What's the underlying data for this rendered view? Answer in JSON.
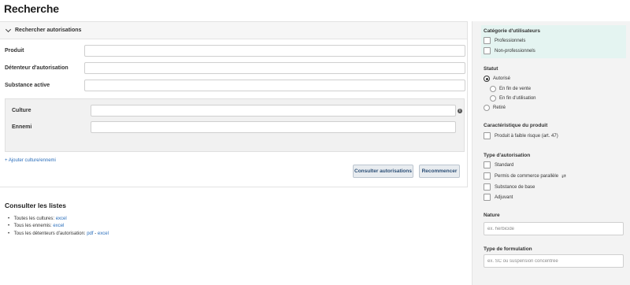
{
  "page": {
    "title": "Recherche"
  },
  "search": {
    "header_label": "Rechercher autorisations",
    "fields": {
      "produit_label": "Produit",
      "detenteur_label": "Détenteur d'autorisation",
      "substance_label": "Substance active",
      "culture_label": "Culture",
      "ennemi_label": "Ennemi"
    },
    "add_link": "+ Ajouter culture/ennemi",
    "submit_label": "Consulter autorisations",
    "reset_label": "Recommencer",
    "info_glyph": "i"
  },
  "lists": {
    "title": "Consulter les listes",
    "items": [
      {
        "label": "Toutes les cultures: ",
        "links": [
          "excel"
        ]
      },
      {
        "label": "Tous les ennemis: ",
        "links": [
          "excel"
        ]
      },
      {
        "label": "Tous les détenteurs d'autorisation: ",
        "links": [
          "pdf",
          "excel"
        ],
        "separator": " - "
      }
    ]
  },
  "sidebar": {
    "categorie": {
      "title": "Catégorie d'utilisateurs",
      "options": [
        "Professionnels",
        "Non-professionnels"
      ]
    },
    "statut": {
      "title": "Statut",
      "options": [
        "Autorisé",
        "En fin de vente",
        "En fin d'utilisation",
        "Retiré"
      ],
      "selected": "Autorisé"
    },
    "caracteristique": {
      "title": "Caractéristique du produit",
      "options": [
        "Produit à faible risque (art. 47)"
      ]
    },
    "type_autorisation": {
      "title": "Type d'autorisation",
      "options": [
        "Standard",
        "Permis de commerce parallèle",
        "Substance de base",
        "Adjuvant"
      ],
      "swap_glyph": "⇄"
    },
    "nature": {
      "title": "Nature",
      "placeholder": "ex. herbicide"
    },
    "formulation": {
      "title": "Type de formulation",
      "placeholder": "ex. SC ou suspension concentrée"
    }
  }
}
